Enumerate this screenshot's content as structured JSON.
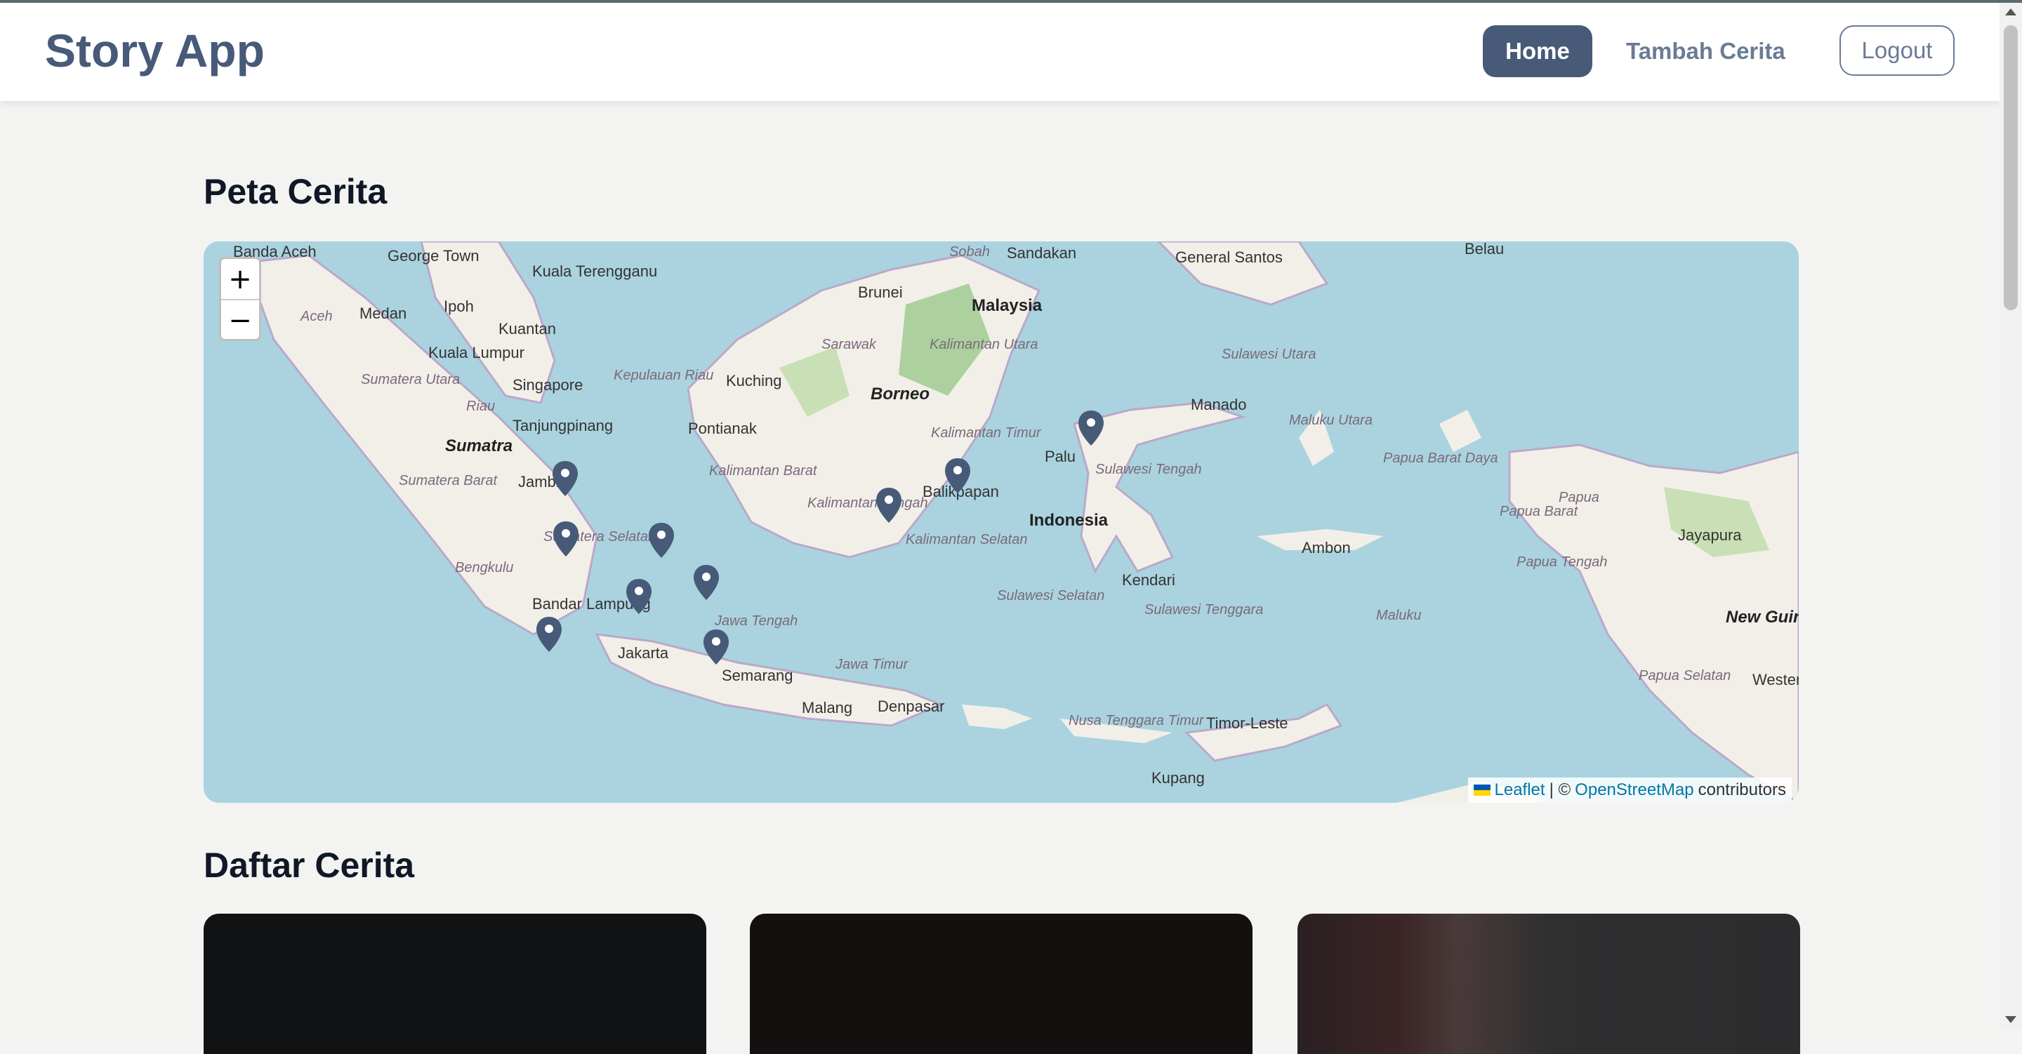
{
  "header": {
    "title": "Story App",
    "nav": {
      "home": "Home",
      "add_story": "Tambah Cerita",
      "logout": "Logout"
    }
  },
  "map_section": {
    "title": "Peta Cerita",
    "zoom_in": "+",
    "zoom_out": "−",
    "attribution": {
      "leaflet": "Leaflet",
      "separator": "| ©",
      "osm": "OpenStreetMap",
      "contributors": "contributors"
    },
    "labels": [
      "Banda Aceh",
      "George Town",
      "Kuala Terengganu",
      "Sobah",
      "Sandakan",
      "General Santos",
      "Belau",
      "Brunei",
      "Malaysia",
      "Ipoh",
      "Medan",
      "Aceh",
      "Kuantan",
      "Kuala Lumpur",
      "Sarawak",
      "Kalimantan Utara",
      "Singapore",
      "Sumatera Utara",
      "Kepulauan Riau",
      "Kuching",
      "Borneo",
      "Riau",
      "Tanjungpinang",
      "Pontianak",
      "Kalimantan Timur",
      "Manado",
      "Sulawesi Utara",
      "Maluku Utara",
      "Sumatra",
      "Palu",
      "Papua Barat Daya",
      "Papua",
      "Jambi",
      "Kalimantan Barat",
      "Balikpapan",
      "Sulawesi Tengah",
      "Sumatera Barat",
      "Kalimantan Tengah",
      "Indonesia",
      "Papua Barat",
      "Jayapura",
      "Sumatera Selatan",
      "Ambon",
      "Kalimantan Selatan",
      "Bengkulu",
      "Kendari",
      "Papua Tengah",
      "Sulawesi Selatan",
      "Bandar Lampung",
      "Sulawesi Tenggara",
      "Maluku",
      "New Guinea",
      "Jawa Tengah",
      "Jakarta",
      "Jawa Timur",
      "Semarang",
      "Papua Selatan",
      "Western",
      "Malang",
      "Denpasar",
      "Timor-Leste",
      "Nusa Tenggara Timur",
      "Kupang"
    ]
  },
  "list_section": {
    "title": "Daftar Cerita",
    "card_count": 3
  },
  "colors": {
    "accent": "#475a78",
    "map_water": "#aad3df",
    "map_land": "#f2efe9",
    "map_forest": "#add19e"
  },
  "icons": [
    "map-marker-icon",
    "ukraine-flag-icon"
  ]
}
